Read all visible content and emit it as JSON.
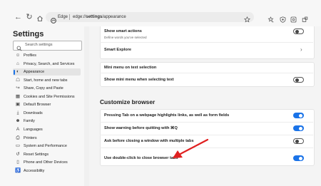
{
  "browser": {
    "brand": "Edge",
    "url_prefix": "edge://",
    "url_bold": "settings",
    "url_suffix": "/appearance"
  },
  "sidebar": {
    "title": "Settings",
    "search_placeholder": "Search settings",
    "items": [
      {
        "label": "Profiles",
        "icon": "profile-icon"
      },
      {
        "label": "Privacy, Search, and Services",
        "icon": "lock-icon"
      },
      {
        "label": "Appearance",
        "icon": "appearance-icon",
        "active": true
      },
      {
        "label": "Start, home and new tabs",
        "icon": "home-icon"
      },
      {
        "label": "Share, Copy and Paste",
        "icon": "share-icon"
      },
      {
        "label": "Cookies and Site Permissions",
        "icon": "cookie-icon"
      },
      {
        "label": "Default Browser",
        "icon": "browser-icon"
      },
      {
        "label": "Downloads",
        "icon": "download-icon"
      },
      {
        "label": "Family",
        "icon": "family-icon"
      },
      {
        "label": "Languages",
        "icon": "language-icon"
      },
      {
        "label": "Printers",
        "icon": "printer-icon"
      },
      {
        "label": "System and Performance",
        "icon": "system-icon"
      },
      {
        "label": "Reset Settings",
        "icon": "reset-icon"
      },
      {
        "label": "Phone and Other Devices",
        "icon": "phone-icon"
      },
      {
        "label": "Accessibility",
        "icon": "accessibility-icon"
      }
    ]
  },
  "content": {
    "smart_actions": {
      "label": "Show smart actions",
      "sub": "Define words you've selected",
      "enabled": false
    },
    "smart_explore": {
      "label": "Smart Explore"
    },
    "mini_menu": {
      "label": "Mini menu on text selection"
    },
    "mini_menu_show": {
      "label": "Show mini menu when selecting text",
      "enabled": false
    },
    "customize_heading": "Customize browser",
    "tab_highlight": {
      "label": "Pressing Tab on a webpage highlights links, as well as form fields",
      "enabled": true
    },
    "quit_warning": {
      "label": "Show warning before quitting with ⌘Q",
      "enabled": true
    },
    "close_multiple": {
      "label": "Ask before closing a window with multiple tabs",
      "enabled": false
    },
    "double_click_close": {
      "label": "Use double-click to close browser tabs",
      "enabled": true
    }
  },
  "colors": {
    "accent": "#1a73e8",
    "arrow": "#e02020"
  }
}
